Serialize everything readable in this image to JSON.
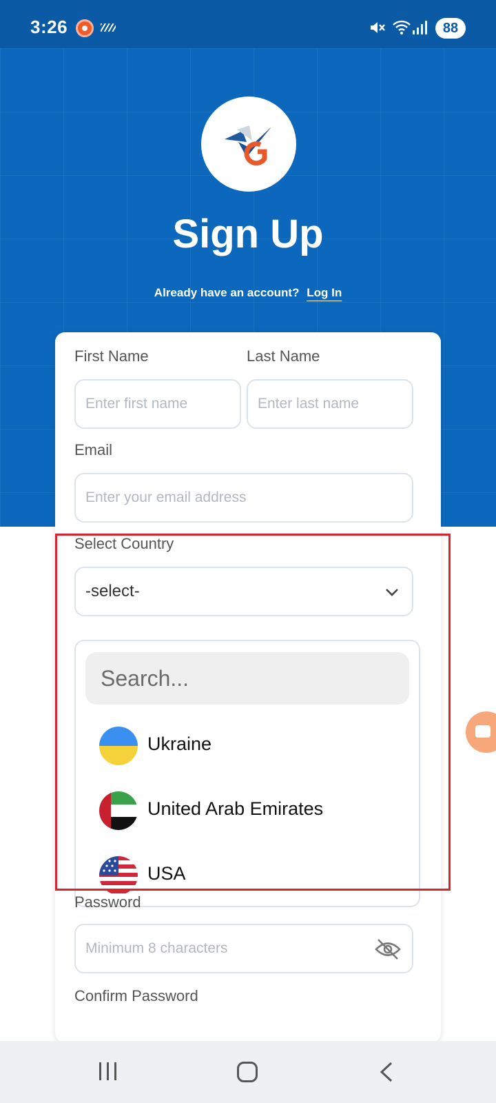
{
  "status_bar": {
    "time": "3:26",
    "battery": "88",
    "icons": [
      "screen-record-icon",
      "signal-stripes-icon",
      "mute-icon",
      "wifi-icon",
      "cellular-icon"
    ]
  },
  "header": {
    "title": "Sign Up",
    "login_prompt": "Already have an account?",
    "login_link": "Log In"
  },
  "form": {
    "first_name_label": "First Name",
    "first_name_placeholder": "Enter first name",
    "last_name_label": "Last Name",
    "last_name_placeholder": "Enter last name",
    "email_label": "Email",
    "email_placeholder": "Enter your email address",
    "country_label": "Select Country",
    "country_value": "-select-",
    "country_search_placeholder": "Search...",
    "countries": [
      {
        "name": "Ukraine",
        "flag": "ukraine-flag"
      },
      {
        "name": "United Arab Emirates",
        "flag": "uae-flag"
      },
      {
        "name": "USA",
        "flag": "usa-flag"
      }
    ],
    "password_label": "Password",
    "password_placeholder": "Minimum 8 characters",
    "confirm_password_label": "Confirm Password"
  },
  "colors": {
    "hero_blue": "#0b68bd",
    "status_blue": "#0b5aa6",
    "highlight_red": "#d9232d",
    "logo_orange": "#e8582a"
  }
}
